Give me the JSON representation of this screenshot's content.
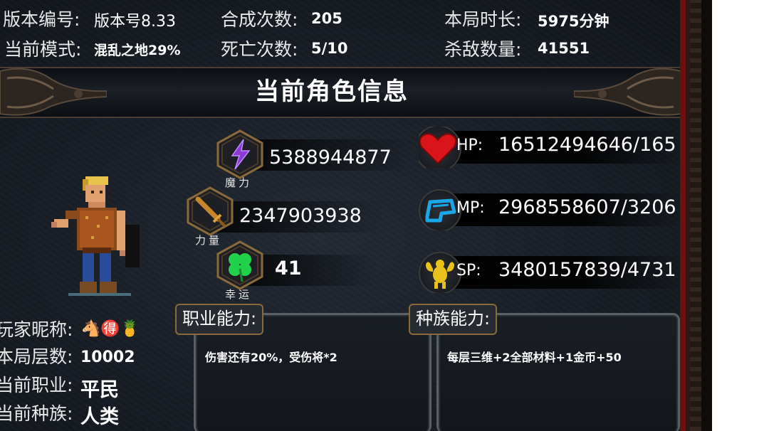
{
  "top_stats": {
    "version_label": "版本编号:",
    "version_value": "版本号8.33",
    "mode_label": "当前模式:",
    "mode_value": "混乱之地29%",
    "synth_label": "合成次数:",
    "synth_value": "205",
    "death_label": "死亡次数:",
    "death_value": "5/10",
    "duration_label": "本局时长:",
    "duration_value": "5975分钟",
    "kills_label": "杀敌数量:",
    "kills_value": "41551"
  },
  "section_title": "当前角色信息",
  "attributes": {
    "magic": {
      "value": "5388944877",
      "caption": "魔力",
      "icon": "lightning-icon"
    },
    "strength": {
      "value": "2347903938",
      "caption": "力量",
      "icon": "sword-icon"
    },
    "luck": {
      "value": "41",
      "caption": "幸运",
      "icon": "clover-icon"
    }
  },
  "resources": {
    "hp": {
      "key": "HP:",
      "value": "16512494646/165",
      "icon": "heart-icon"
    },
    "mp": {
      "key": "MP:",
      "value": "2968558607/3206",
      "icon": "helmet-icon"
    },
    "sp": {
      "key": "SP:",
      "value": "3480157839/4731",
      "icon": "muscle-icon"
    }
  },
  "player": {
    "nickname_label": "玩家昵称:",
    "nickname_emojis": "🐴🉐🍍",
    "floor_label": "本局层数:",
    "floor_value": "10002",
    "job_label": "当前职业:",
    "job_value": "平民",
    "race_label": "当前种族:",
    "race_value": "人类"
  },
  "abilities": {
    "job_title": "职业能力:",
    "job_text": "伤害还有20%，受伤将*2",
    "race_title": "种族能力:",
    "race_text": "每层三维+2全部材料+1金币+50"
  },
  "colors": {
    "hp_heart": "#d9141a",
    "mp_blue": "#1aa7e8",
    "sp_gold": "#e8c21a",
    "magic_purple": "#8a3bd6",
    "luck_green": "#22d14a",
    "frame_brown": "#8a6a3a"
  }
}
